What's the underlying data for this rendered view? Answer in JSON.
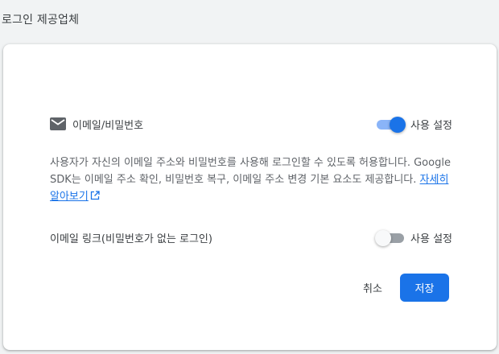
{
  "section": {
    "title": "로그인 제공업체"
  },
  "providers": {
    "email_password": {
      "icon": "mail-icon",
      "label": "이메일/비밀번호",
      "toggle_label": "사용 설정",
      "enabled": true
    },
    "description": {
      "text": "사용자가 자신의 이메일 주소와 비밀번호를 사용해 로그인할 수 있도록 허용합니다. Google SDK는 이메일 주소 확인, 비밀번호 복구, 이메일 주소 변경 기본 요소도 제공합니다. ",
      "link_text": "자세히 알아보기",
      "link_icon": "external-link-icon"
    },
    "email_link": {
      "label": "이메일 링크(비밀번호가 없는 로그인)",
      "toggle_label": "사용 설정",
      "enabled": false
    }
  },
  "actions": {
    "cancel_label": "취소",
    "save_label": "저장"
  },
  "colors": {
    "accent": "#1a73e8",
    "toggle_on_track": "#8ab4f8",
    "toggle_off_track": "#9aa0a6"
  }
}
